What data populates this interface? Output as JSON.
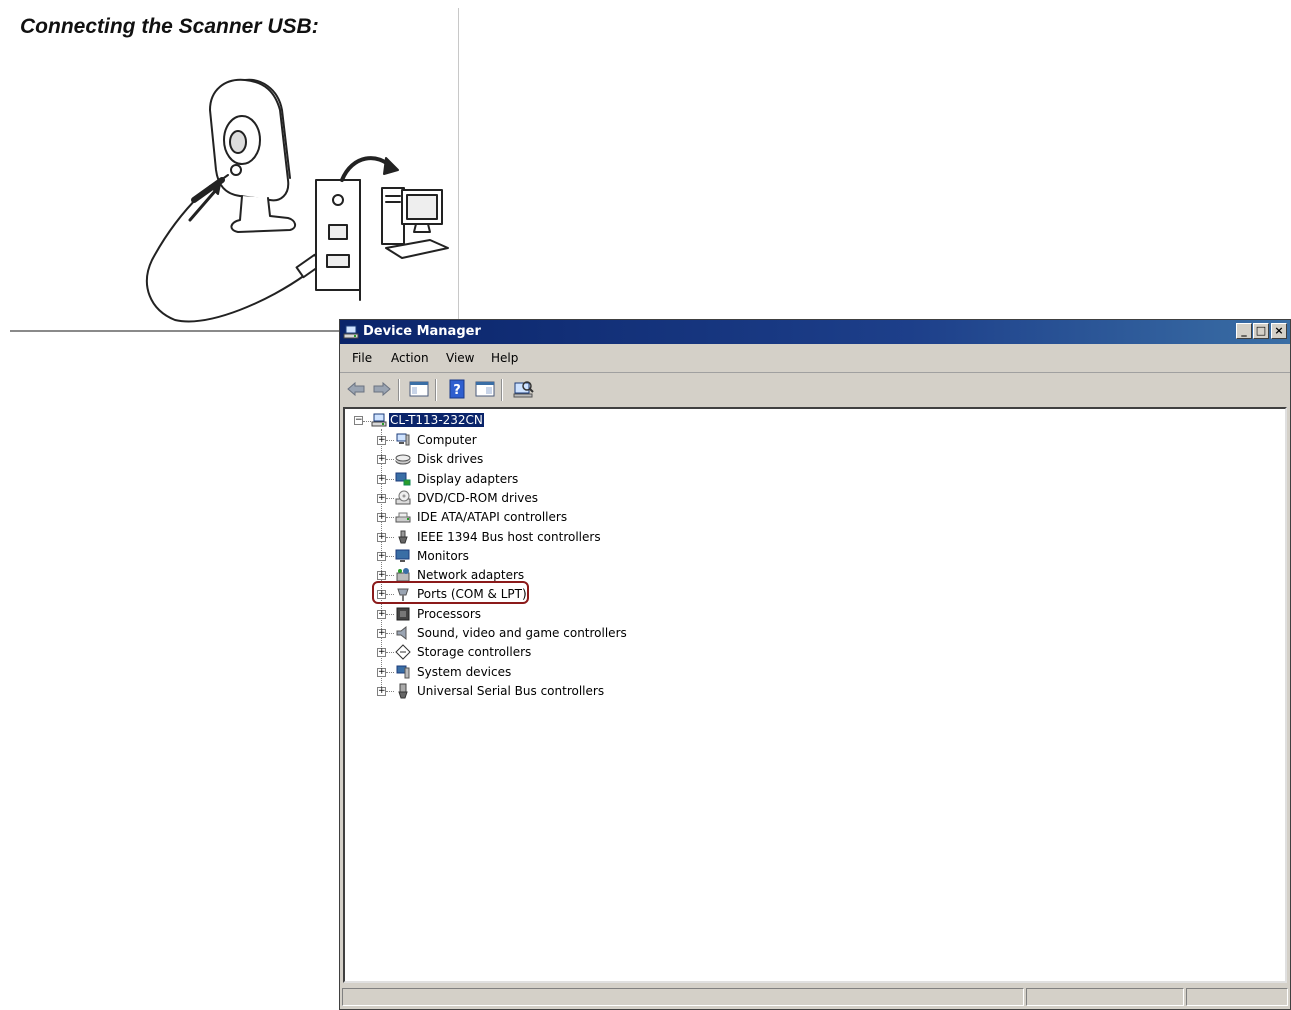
{
  "manual": {
    "title": "Connecting the Scanner USB:"
  },
  "window": {
    "title": "Device Manager",
    "minimize_glyph": "_",
    "maximize_glyph": "□",
    "close_glyph": "×"
  },
  "menu": {
    "file": "File",
    "action": "Action",
    "view": "View",
    "help": "Help"
  },
  "toolbar": [
    "back-arrow-icon",
    "forward-arrow-icon",
    "show-hide-console-tree-icon",
    "help-icon",
    "properties-icon",
    "scan-hardware-icon"
  ],
  "tree": {
    "root": "CL-T113-232CN",
    "root_expander": "−",
    "expander": "+",
    "highlighted_item": "Ports (COM & LPT)",
    "items": [
      {
        "label": "Computer",
        "icon": "computer-icon"
      },
      {
        "label": "Disk drives",
        "icon": "disk-drive-icon"
      },
      {
        "label": "Display adapters",
        "icon": "display-adapter-icon"
      },
      {
        "label": "DVD/CD-ROM drives",
        "icon": "dvd-drive-icon"
      },
      {
        "label": "IDE ATA/ATAPI controllers",
        "icon": "ide-controller-icon"
      },
      {
        "label": "IEEE 1394 Bus host controllers",
        "icon": "ieee1394-icon"
      },
      {
        "label": "Monitors",
        "icon": "monitor-icon"
      },
      {
        "label": "Network adapters",
        "icon": "network-adapter-icon"
      },
      {
        "label": "Ports (COM & LPT)",
        "icon": "port-icon"
      },
      {
        "label": "Processors",
        "icon": "processor-icon"
      },
      {
        "label": "Sound, video and game controllers",
        "icon": "sound-icon"
      },
      {
        "label": "Storage controllers",
        "icon": "storage-controller-icon"
      },
      {
        "label": "System devices",
        "icon": "system-devices-icon"
      },
      {
        "label": "Universal Serial Bus controllers",
        "icon": "usb-icon"
      }
    ]
  }
}
